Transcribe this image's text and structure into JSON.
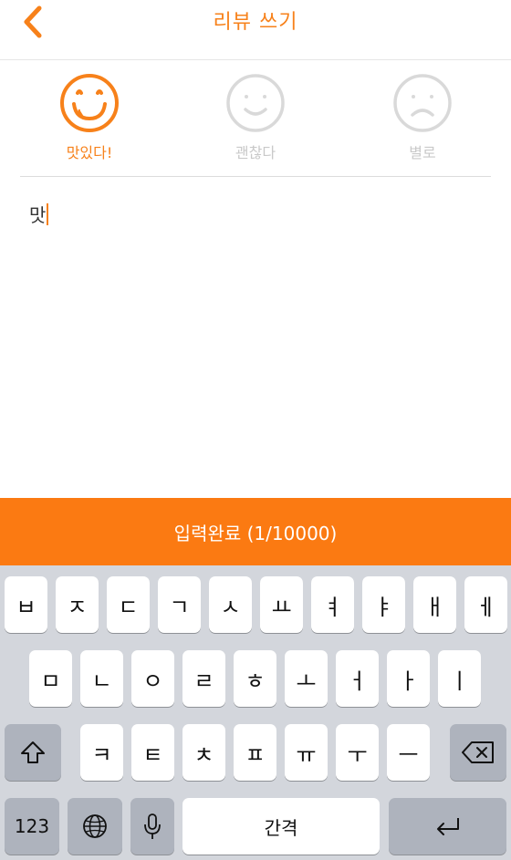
{
  "header": {
    "title": "리뷰 쓰기",
    "back_icon": "chevron-left-icon"
  },
  "ratings": [
    {
      "label": "맛있다!",
      "icon": "delicious-face-icon",
      "selected": true
    },
    {
      "label": "괜찮다",
      "icon": "smile-face-icon",
      "selected": false
    },
    {
      "label": "별로",
      "icon": "sad-face-icon",
      "selected": false
    }
  ],
  "review": {
    "text": "맛"
  },
  "submit": {
    "label": "입력완료 (1/10000)"
  },
  "colors": {
    "accent": "#f7811a",
    "bar": "#fb7a12",
    "inactive": "#c9c9c9"
  },
  "keyboard": {
    "row1": [
      "ㅂ",
      "ㅈ",
      "ㄷ",
      "ㄱ",
      "ㅅ",
      "ㅛ",
      "ㅕ",
      "ㅑ",
      "ㅐ",
      "ㅔ"
    ],
    "row2": [
      "ㅁ",
      "ㄴ",
      "ㅇ",
      "ㄹ",
      "ㅎ",
      "ㅗ",
      "ㅓ",
      "ㅏ",
      "ㅣ"
    ],
    "row3": [
      "ㅋ",
      "ㅌ",
      "ㅊ",
      "ㅍ",
      "ㅠ",
      "ㅜ",
      "ㅡ"
    ],
    "numbers_label": "123",
    "space_label": "간격",
    "shift_icon": "shift-icon",
    "backspace_icon": "backspace-icon",
    "globe_icon": "globe-icon",
    "mic_icon": "microphone-icon",
    "return_icon": "return-icon"
  }
}
